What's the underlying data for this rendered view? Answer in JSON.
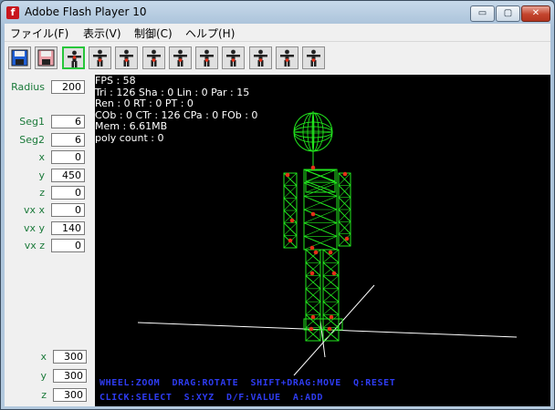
{
  "window": {
    "title": "Adobe Flash Player 10",
    "minimize": "▭",
    "maximize": "▢",
    "close": "✕"
  },
  "menu": [
    "ファイル(F)",
    "表示(V)",
    "制御(C)",
    "ヘルプ(H)"
  ],
  "toolbar": {
    "buttons": [
      {
        "name": "save-blue",
        "icon": "floppy-icon"
      },
      {
        "name": "save-pink",
        "icon": "floppy-icon"
      },
      {
        "name": "pose-1",
        "icon": "figure-icon",
        "selected": true
      },
      {
        "name": "pose-2",
        "icon": "figure-icon"
      },
      {
        "name": "pose-3",
        "icon": "figure-icon"
      },
      {
        "name": "pose-4",
        "icon": "figure-icon"
      },
      {
        "name": "pose-5",
        "icon": "figure-icon"
      },
      {
        "name": "pose-6",
        "icon": "figure-icon"
      },
      {
        "name": "pose-7",
        "icon": "figure-icon"
      },
      {
        "name": "pose-8",
        "icon": "figure-icon"
      },
      {
        "name": "pose-9",
        "icon": "figure-icon"
      },
      {
        "name": "pose-10",
        "icon": "figure-icon"
      }
    ]
  },
  "params": {
    "radius": {
      "label": "Radius",
      "value": "200"
    },
    "seg1": {
      "label": "Seg1",
      "value": "6"
    },
    "seg2": {
      "label": "Seg2",
      "value": "6"
    },
    "x": {
      "label": "x",
      "value": "0"
    },
    "y": {
      "label": "y",
      "value": "450"
    },
    "z": {
      "label": "z",
      "value": "0"
    },
    "vx_x": {
      "label": "vx x",
      "value": "0"
    },
    "vx_y": {
      "label": "vx y",
      "value": "140"
    },
    "vx_z": {
      "label": "vx z",
      "value": "0"
    }
  },
  "camera": {
    "x": {
      "label": "x",
      "value": "300"
    },
    "y": {
      "label": "y",
      "value": "300"
    },
    "z": {
      "label": "z",
      "value": "300"
    }
  },
  "stats": [
    "FPS : 58",
    "Tri : 126 Sha : 0 Lin : 0 Par : 15",
    "Ren : 0 RT : 0 PT : 0",
    "COb : 0 CTr : 126 CPa : 0 FOb : 0",
    "Mem : 6.61MB",
    "poly count : 0"
  ],
  "hints": {
    "line1": "WHEEL:ZOOM  DRAG:ROTATE  SHIFT+DRAG:MOVE  Q:RESET",
    "line2": "CLICK:SELECT  S:XYZ  D/F:VALUE  A:ADD"
  },
  "colors": {
    "wire": "#22e81e",
    "joint": "#e53018",
    "axis": "#ffffff",
    "hint": "#2e3cf2",
    "label": "#1b7a3a"
  }
}
